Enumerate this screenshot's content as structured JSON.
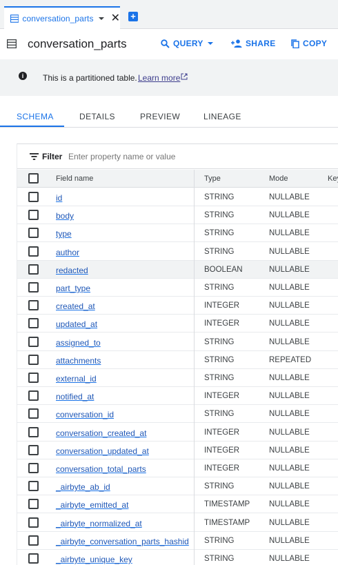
{
  "tab": {
    "label": "conversation_parts",
    "close": "✕"
  },
  "header": {
    "title": "conversation_parts",
    "query_label": "QUERY",
    "share_label": "SHARE",
    "copy_label": "COPY"
  },
  "banner": {
    "message": "This is a partitioned table.",
    "link": "Learn more"
  },
  "detail_tabs": [
    "SCHEMA",
    "DETAILS",
    "PREVIEW",
    "LINEAGE"
  ],
  "filter": {
    "label": "Filter",
    "placeholder": "Enter property name or value"
  },
  "columns": {
    "field": "Field name",
    "type": "Type",
    "mode": "Mode",
    "key": "Key"
  },
  "rows": [
    {
      "name": "id",
      "type": "STRING",
      "mode": "NULLABLE"
    },
    {
      "name": "body",
      "type": "STRING",
      "mode": "NULLABLE"
    },
    {
      "name": "type",
      "type": "STRING",
      "mode": "NULLABLE"
    },
    {
      "name": "author",
      "type": "STRING",
      "mode": "NULLABLE"
    },
    {
      "name": "redacted",
      "type": "BOOLEAN",
      "mode": "NULLABLE"
    },
    {
      "name": "part_type",
      "type": "STRING",
      "mode": "NULLABLE"
    },
    {
      "name": "created_at",
      "type": "INTEGER",
      "mode": "NULLABLE"
    },
    {
      "name": "updated_at",
      "type": "INTEGER",
      "mode": "NULLABLE"
    },
    {
      "name": "assigned_to",
      "type": "STRING",
      "mode": "NULLABLE"
    },
    {
      "name": "attachments",
      "type": "STRING",
      "mode": "REPEATED"
    },
    {
      "name": "external_id",
      "type": "STRING",
      "mode": "NULLABLE"
    },
    {
      "name": "notified_at",
      "type": "INTEGER",
      "mode": "NULLABLE"
    },
    {
      "name": "conversation_id",
      "type": "STRING",
      "mode": "NULLABLE"
    },
    {
      "name": "conversation_created_at",
      "type": "INTEGER",
      "mode": "NULLABLE"
    },
    {
      "name": "conversation_updated_at",
      "type": "INTEGER",
      "mode": "NULLABLE"
    },
    {
      "name": "conversation_total_parts",
      "type": "INTEGER",
      "mode": "NULLABLE"
    },
    {
      "name": "_airbyte_ab_id",
      "type": "STRING",
      "mode": "NULLABLE"
    },
    {
      "name": "_airbyte_emitted_at",
      "type": "TIMESTAMP",
      "mode": "NULLABLE"
    },
    {
      "name": "_airbyte_normalized_at",
      "type": "TIMESTAMP",
      "mode": "NULLABLE"
    },
    {
      "name": "_airbyte_conversation_parts_hashid",
      "type": "STRING",
      "mode": "NULLABLE"
    },
    {
      "name": "_airbyte_unique_key",
      "type": "STRING",
      "mode": "NULLABLE"
    }
  ],
  "highlighted_row": "redacted",
  "colors": {
    "accent": "#1a73e8",
    "banner_bg": "#f1f3f4",
    "header_bg": "#f1f3f4"
  }
}
